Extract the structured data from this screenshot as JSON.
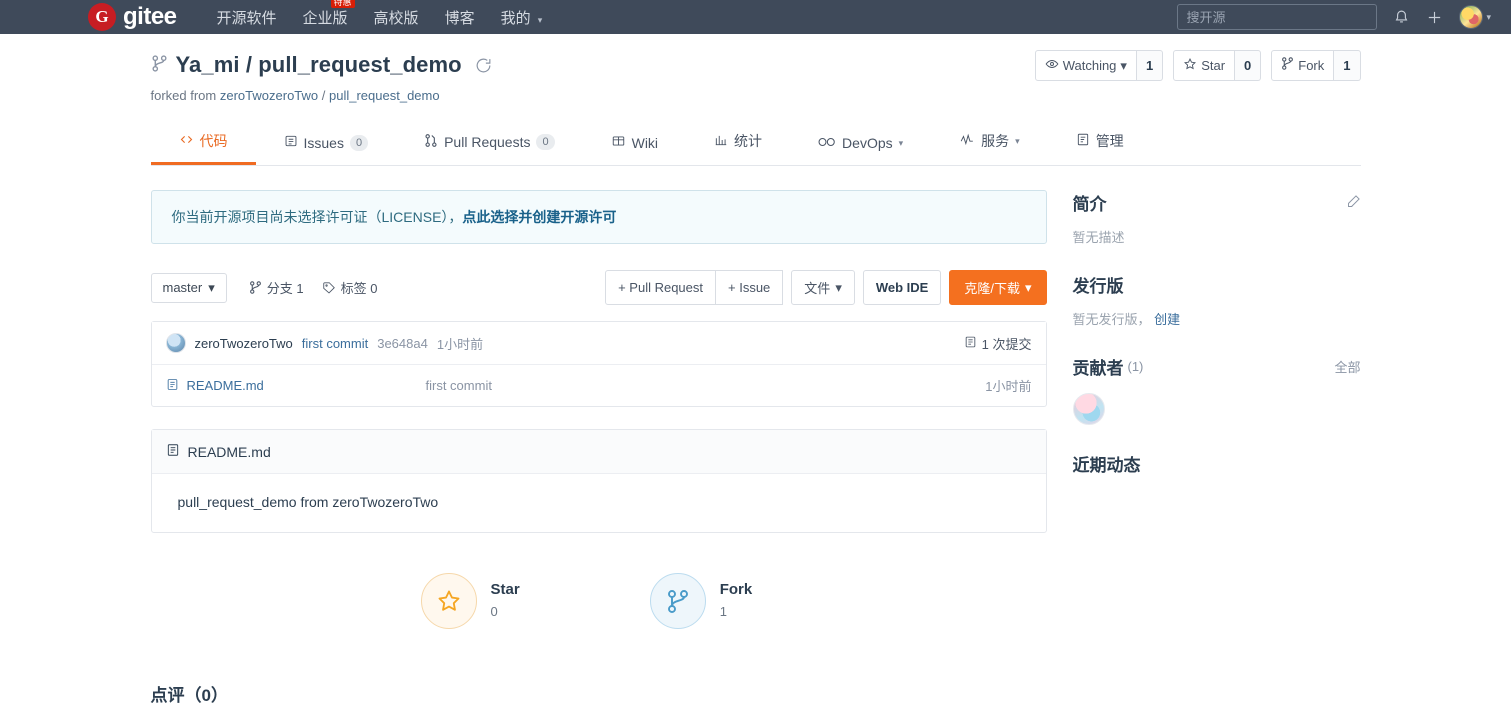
{
  "topnav": {
    "logo_text": "gitee",
    "logo_mark": "G",
    "links": [
      {
        "label": "开源软件",
        "caret": false,
        "badge": null
      },
      {
        "label": "企业版",
        "caret": false,
        "badge": "特惠"
      },
      {
        "label": "高校版",
        "caret": false,
        "badge": null
      },
      {
        "label": "博客",
        "caret": false,
        "badge": null
      },
      {
        "label": "我的",
        "caret": true,
        "badge": null
      }
    ],
    "search_placeholder": "搜开源",
    "search_value": "",
    "bell_icon": "bell-icon",
    "plus_icon": "plus-icon",
    "avatar_icon": "user-avatar",
    "caret": "▾"
  },
  "repo": {
    "owner": "Ya_mi",
    "separator": "/",
    "name": "pull_request_demo",
    "fork_icon": "fork-icon",
    "sync_icon": "sync-icon",
    "forked_prefix": "forked from",
    "forked_owner": "zeroTwozeroTwo",
    "forked_separator": "/",
    "forked_repo": "pull_request_demo",
    "actions": [
      {
        "icon": "eye-icon",
        "label": "Watching",
        "caret": "▾",
        "count": "1"
      },
      {
        "icon": "star-icon",
        "label": "Star",
        "caret": "",
        "count": "0"
      },
      {
        "icon": "fork-icon",
        "label": "Fork",
        "caret": "",
        "count": "1"
      }
    ]
  },
  "tabs": [
    {
      "icon": "code-icon",
      "label": "代码",
      "count": null,
      "caret": null,
      "active": true
    },
    {
      "icon": "issue-icon",
      "label": "Issues",
      "count": "0",
      "caret": null,
      "active": false
    },
    {
      "icon": "pull-request-icon",
      "label": "Pull Requests",
      "count": "0",
      "caret": null,
      "active": false
    },
    {
      "icon": "wiki-icon",
      "label": "Wiki",
      "count": null,
      "caret": null,
      "active": false
    },
    {
      "icon": "chart-icon",
      "label": "统计",
      "count": null,
      "caret": null,
      "active": false
    },
    {
      "icon": "devops-icon",
      "label": "DevOps",
      "count": null,
      "caret": "▾",
      "active": false
    },
    {
      "icon": "service-icon",
      "label": "服务",
      "count": null,
      "caret": "▾",
      "active": false
    },
    {
      "icon": "manage-icon",
      "label": "管理",
      "count": null,
      "caret": null,
      "active": false
    }
  ],
  "notice": {
    "text": "你当前开源项目尚未选择许可证（LICENSE），",
    "link": "点此选择并创建开源许可"
  },
  "toolbar": {
    "branch": "master",
    "branch_caret": "▾",
    "branches_icon": "branch-icon",
    "branches_label": "分支 1",
    "tags_icon": "tag-icon",
    "tags_label": "标签 0",
    "pull_request_label": "+ Pull Request",
    "issue_label": "+ Issue",
    "files_label": "文件",
    "files_caret": "▾",
    "webide_label": "Web IDE",
    "clone_label": "克隆/下载",
    "clone_caret": "▾",
    "clone_color": "#f4701f"
  },
  "commit": {
    "author": "zeroTwozeroTwo",
    "message": "first commit",
    "sha": "3e648a4",
    "time": "1小时前",
    "count_icon": "history-icon",
    "count_label": "1 次提交"
  },
  "files": [
    {
      "icon": "file-icon",
      "name": "README.md",
      "commit": "first commit",
      "time": "1小时前"
    }
  ],
  "readme": {
    "icon": "file-icon",
    "title": "README.md",
    "body": "pull_request_demo from zeroTwozeroTwo"
  },
  "big_actions": [
    {
      "icon": "star-icon",
      "label": "Star",
      "count": "0",
      "color": "#f5a623"
    },
    {
      "icon": "fork-icon",
      "label": "Fork",
      "count": "1",
      "color": "#4a9bc9"
    }
  ],
  "comments": {
    "title": "点评（0）"
  },
  "sidebar": {
    "about": {
      "title": "简介",
      "edit_icon": "edit-icon",
      "text": "暂无描述"
    },
    "releases": {
      "title": "发行版",
      "text": "暂无发行版，",
      "link": "创建"
    },
    "contributors": {
      "title": "贡献者",
      "count": "(1)",
      "all_label": "全部",
      "avatar_icon": "contributor-avatar"
    },
    "activity": {
      "title": "近期动态"
    }
  }
}
